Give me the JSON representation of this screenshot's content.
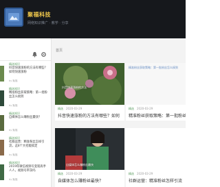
{
  "header": {
    "site_name": "聚福科技",
    "tagline": "网络知识推广 · 教学 · 分享"
  },
  "sidebar": {
    "items": [
      {
        "tag": "精选知识",
        "text": "抖音快速涨粉的方法有哪些？如何快速涨粉",
        "meta": "by 聚福"
      },
      {
        "tag": "精选知识",
        "text": "精准粉丝获取策略：第一批粉丝怎么搞到",
        "meta": "by 聚福"
      },
      {
        "tag": "精选知识",
        "text": "自媒体怎么赚粉丝最快？",
        "meta": "by 聚福"
      },
      {
        "tag": "精选知识",
        "text": "社群运营：精准粉丝怎样引流，这8个大招能搞定",
        "meta": "by 聚福"
      },
      {
        "tag": "精选知识",
        "text": "2019年微信视频号变现高手人人，视频号带货吗",
        "meta": "by 聚福"
      }
    ]
  },
  "main": {
    "breadcrumb": "首页",
    "cards": [
      {
        "tag": "精选",
        "date": "2020-03-29",
        "title": "抖音快速涨粉的方法有哪些？如何",
        "caption": "抖音快速涨粉的方法"
      },
      {
        "tag": "精选",
        "date": "2020-03-29",
        "title": "精准粉丝获取策略：第一批粉丝",
        "caption": "精准粉丝获取策略：第一批粉丝怎么搞到"
      },
      {
        "tag": "精选",
        "date": "2020-03-29",
        "title": "自媒体怎么赚粉丝最快？",
        "caption": "自媒体怎么赚粉丝最快"
      },
      {
        "tag": "精选",
        "date": "2020-03-29",
        "title": "社群运营：精准粉丝怎样引流",
        "caption": ""
      }
    ]
  }
}
